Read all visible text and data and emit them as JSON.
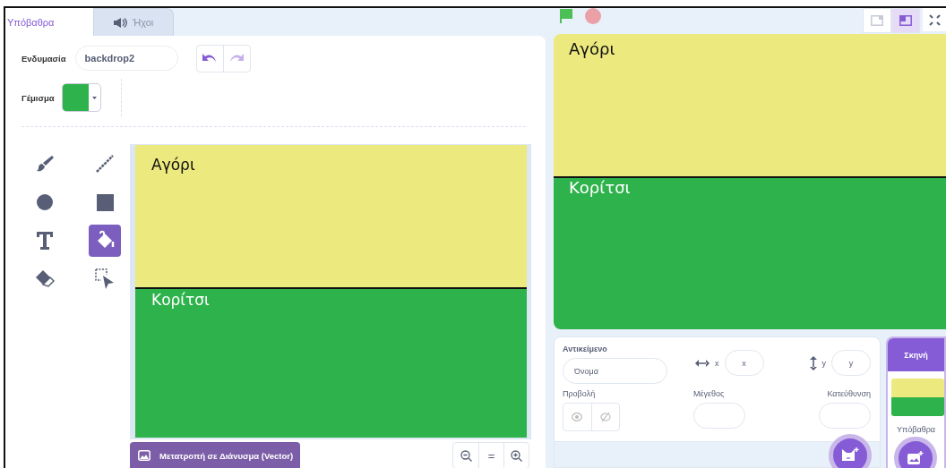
{
  "tabs": [
    {
      "label": "Υπόβαθρα",
      "kind": "plain",
      "selected": true
    },
    {
      "label": "Ήχοι",
      "kind": "sound",
      "selected": false
    }
  ],
  "costume": {
    "label": "Ενδυμασία",
    "value": "backdrop2"
  },
  "fill": {
    "label": "Γέμισμα",
    "color": "#2eb24c"
  },
  "tools": [
    {
      "kind": "brush",
      "selected": false
    },
    {
      "kind": "line",
      "selected": false
    },
    {
      "kind": "circle",
      "selected": false
    },
    {
      "kind": "rectangle",
      "selected": false
    },
    {
      "kind": "text",
      "selected": false
    },
    {
      "kind": "fill",
      "selected": true
    },
    {
      "kind": "eraser",
      "selected": false
    },
    {
      "kind": "select",
      "selected": false
    }
  ],
  "canvas": {
    "top_text": "Αγόρι",
    "bottom_text": "Κορίτσι"
  },
  "convert_button": "Μετατροπή σε Διάνυσμα (Vector)",
  "zoom_reset": "=",
  "layout_modes": [
    {
      "kind": "large",
      "selected": false
    },
    {
      "kind": "small",
      "selected": true
    }
  ],
  "stage": {
    "top_text": "Αγόρι",
    "bottom_text": "Κορίτσι"
  },
  "sprite_info": {
    "title": "Αντικείμενο",
    "name_placeholder": "Όνομα",
    "x_label": "x",
    "x_placeholder": "x",
    "y_label": "y",
    "y_placeholder": "y",
    "show_label": "Προβολή",
    "size_label": "Μέγεθος",
    "direction_label": "Κατεύθυνση"
  },
  "stage_panel": {
    "title": "Σκηνή",
    "backdrops_label": "Υπόβαθρα"
  }
}
